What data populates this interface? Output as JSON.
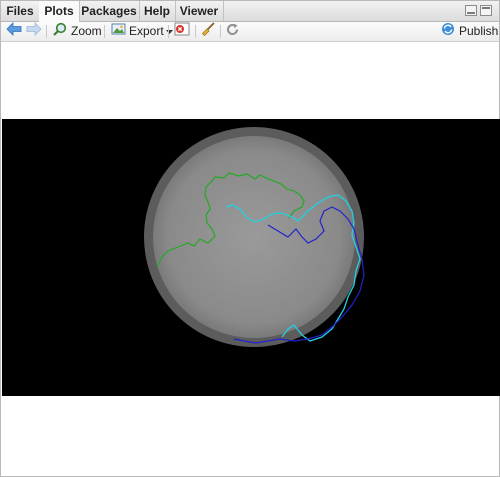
{
  "tabs": [
    {
      "label": "Files",
      "active": false
    },
    {
      "label": "Plots",
      "active": true
    },
    {
      "label": "Packages",
      "active": false
    },
    {
      "label": "Help",
      "active": false
    },
    {
      "label": "Viewer",
      "active": false
    }
  ],
  "toolbar": {
    "back_icon": "arrow-left-icon",
    "forward_icon": "arrow-right-icon",
    "zoom_label": "Zoom",
    "export_label": "Export",
    "remove_icon": "remove-plot-icon",
    "clear_icon": "broom-icon",
    "refresh_icon": "refresh-icon",
    "publish_label": "Publish"
  },
  "plot": {
    "background": "#000000",
    "globe_fill": "#8c8c8c",
    "series_colors": [
      "#22aa22",
      "#22d0e0",
      "#2222cc"
    ]
  }
}
